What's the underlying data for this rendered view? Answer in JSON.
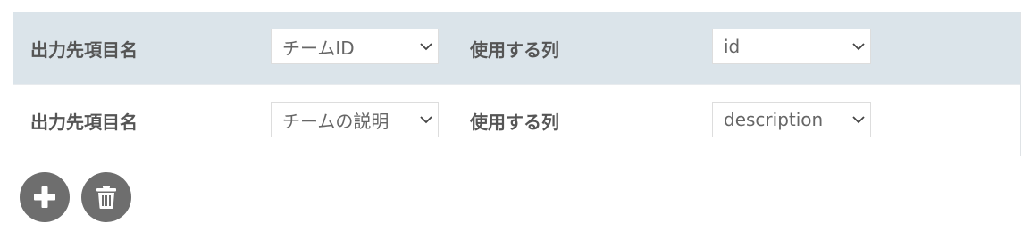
{
  "mapping": {
    "rows": [
      {
        "target_label": "出力先項目名",
        "target_value": "チームID",
        "source_label": "使用する列",
        "source_value": "id"
      },
      {
        "target_label": "出力先項目名",
        "target_value": "チームの説明",
        "source_label": "使用する列",
        "source_value": "description"
      }
    ]
  },
  "actions": {
    "add_icon": "plus-icon",
    "delete_icon": "trash-icon"
  },
  "colors": {
    "header_row_bg": "#dbe4ea",
    "button_bg": "#6e6e6e",
    "label_text": "#555555"
  }
}
